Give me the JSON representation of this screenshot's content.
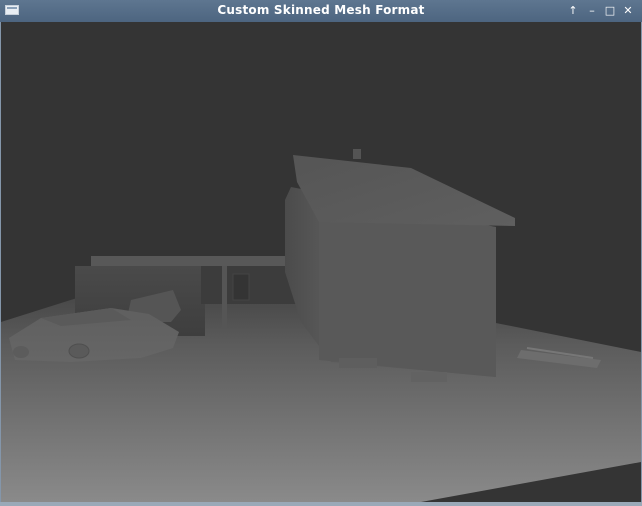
{
  "window": {
    "title": "Custom Skinned Mesh Format",
    "controls": {
      "shade": "↑",
      "minimize": "–",
      "maximize": "□",
      "close": "✕"
    }
  },
  "scene": {
    "objects": [
      "ground-plane",
      "house",
      "carport",
      "car",
      "bench",
      "boxes"
    ]
  },
  "colors": {
    "titlebar": "#58708b",
    "sky": "#343434",
    "ground_near": "#8a8a8a"
  }
}
